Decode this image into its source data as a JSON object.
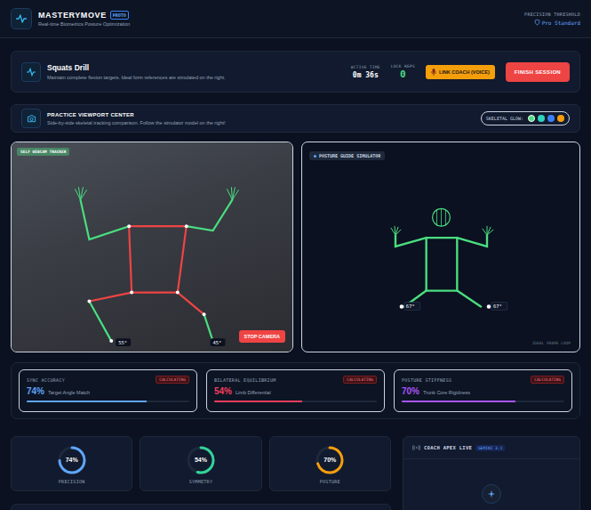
{
  "header": {
    "title": "MASTERYMOVE",
    "badge": "PROTO",
    "subtitle": "Real-time Biometrics Posture Optimization",
    "threshold_label": "PRECISION THRESHOLD",
    "threshold_value": "Pro Standard"
  },
  "drill": {
    "title": "Squats Drill",
    "subtitle": "Maintain complete flexion targets. Ideal form references are simulated on the right.",
    "stats": [
      {
        "label": "ACTIVE TIME",
        "value": "0m 36s"
      },
      {
        "label": "LOCK REPS",
        "value": "0"
      }
    ],
    "link_button": "LINK COACH (VOICE)",
    "finish_button": "FINISH SESSION"
  },
  "viewport": {
    "title": "PRACTICE VIEWPORT CENTER",
    "subtitle": "Side-by-side skeletal tracking comparison. Follow the simulator model on the right!",
    "glow_label": "SKELETAL GLOW:",
    "glow_colors": [
      {
        "color": "#4ade80",
        "selected": true
      },
      {
        "color": "#2dd4bf",
        "selected": false
      },
      {
        "color": "#3b82f6",
        "selected": false
      },
      {
        "color": "#f59e0b",
        "selected": false
      }
    ]
  },
  "webcam": {
    "label": "SELF WEBCAM TRACKER",
    "button": "STOP CAMERA",
    "angles": [
      "55°",
      "45°"
    ]
  },
  "simulator": {
    "label": "POSTURE GUIDE SIMULATOR",
    "angles": [
      "67°",
      "67°"
    ],
    "footer": "IDEAL FRAME LOOP"
  },
  "metrics": [
    {
      "label": "SYNC ACCURACY",
      "status": "CALCULATING",
      "value": "74%",
      "caption": "Target Angle Match",
      "level": 0.74,
      "color": "#60a5fa"
    },
    {
      "label": "BILATERAL EQUILIBRIUM",
      "status": "CALCULATING",
      "value": "54%",
      "caption": "Limb Differential",
      "level": 0.54,
      "color": "#f43f5e"
    },
    {
      "label": "POSTURE STIFFNESS",
      "status": "CALCULATING",
      "value": "70%",
      "caption": "Trunk Core Rigidness",
      "level": 0.7,
      "color": "#a855f7"
    }
  ],
  "rings": [
    {
      "value": "74%",
      "label": "PRECISION",
      "level": 0.74,
      "color": "#60a5fa"
    },
    {
      "value": "54%",
      "label": "SYMMETRY",
      "level": 0.54,
      "color": "#34d399"
    },
    {
      "value": "70%",
      "label": "POSTURE",
      "level": 0.7,
      "color": "#f59e0b"
    }
  ],
  "coach": {
    "title": "COACH APEX LIVE",
    "badge": "GEMINI 3.1"
  }
}
